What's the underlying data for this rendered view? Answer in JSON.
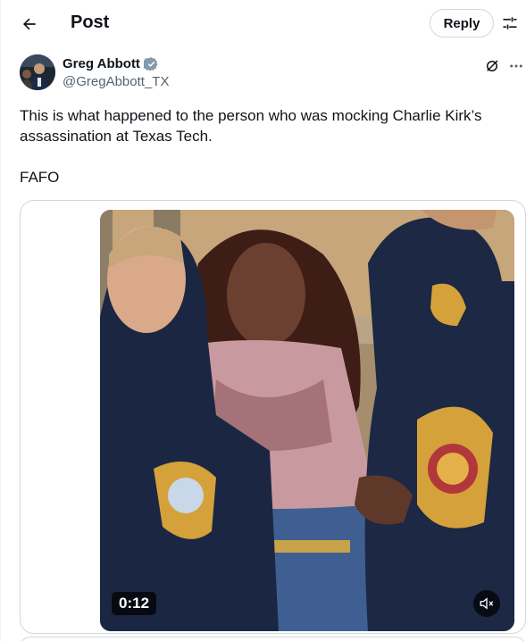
{
  "header": {
    "title": "Post",
    "reply_label": "Reply"
  },
  "author": {
    "name": "Greg Abbott",
    "handle": "@GregAbbott_TX",
    "verified": true,
    "verified_color": "#829aab"
  },
  "post": {
    "text_line1": "This is what happened to the person who was mocking Charlie Kirk’s",
    "text_line2": "assassination at Texas Tech.",
    "text_line3": "FAFO"
  },
  "media": {
    "type": "video",
    "timestamp": "0:12",
    "muted": true
  },
  "icons": {
    "back": "arrow-left-icon",
    "filter": "sliders-icon",
    "verified": "verified-badge-icon",
    "grok": "grok-icon",
    "more": "more-horizontal-icon",
    "mute": "speaker-muted-icon"
  },
  "colors": {
    "text": "#0f1419",
    "secondary": "#536471",
    "border": "#cfd9de"
  }
}
